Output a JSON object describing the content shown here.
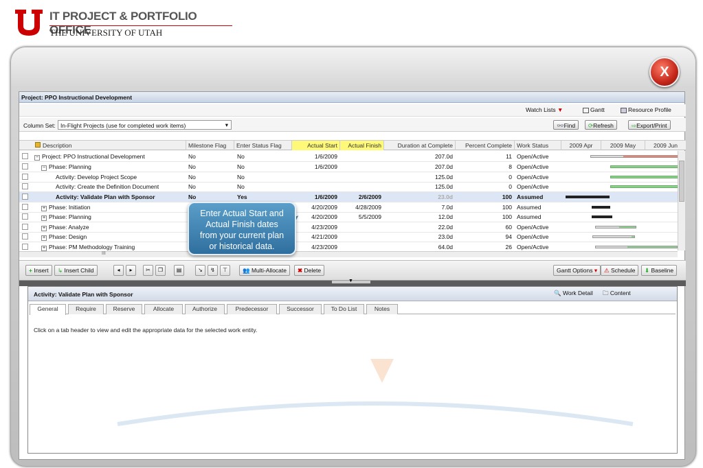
{
  "brand": {
    "title": "IT PROJECT & PORTFOLIO OFFICE",
    "subtitle": "THE UNIVERSITY OF UTAH",
    "logo_letter": "U"
  },
  "close_label": "X",
  "project_bar": "Project: PPO Instructional Development",
  "toolbar": {
    "watch_lists": "Watch Lists",
    "gantt": "Gantt",
    "resource_profile": "Resource Profile"
  },
  "column_set": {
    "label": "Column Set:",
    "value": "In-Flight Projects (use for completed work items)"
  },
  "buttons": {
    "find": "Find",
    "refresh": "Refresh",
    "export": "Export/Print"
  },
  "columns": [
    "Description",
    "Milestone Flag",
    "Enter Status Flag",
    "Actual Start",
    "Actual Finish",
    "Duration at Complete",
    "Percent Complete",
    "Work Status",
    "2009 Apr",
    "2009 May",
    "2009 Jun"
  ],
  "rows": [
    {
      "desc": "Project: PPO Instructional Development",
      "ms": "No",
      "esf": "No",
      "as": "1/6/2009",
      "af": "",
      "dur": "207.0d",
      "pct": "11",
      "ws": "Open/Active"
    },
    {
      "desc": "Phase: Planning",
      "ms": "No",
      "esf": "No",
      "as": "1/6/2009",
      "af": "",
      "dur": "207.0d",
      "pct": "8",
      "ws": "Open/Active"
    },
    {
      "desc": "Activity: Develop Project Scope",
      "ms": "No",
      "esf": "No",
      "as": "",
      "af": "",
      "dur": "125.0d",
      "pct": "0",
      "ws": "Open/Active"
    },
    {
      "desc": "Activity: Create the Definition Document",
      "ms": "No",
      "esf": "No",
      "as": "",
      "af": "",
      "dur": "125.0d",
      "pct": "0",
      "ws": "Open/Active"
    },
    {
      "desc": "Activity: Validate Plan with Sponsor",
      "ms": "No",
      "esf": "Yes",
      "as": "1/6/2009",
      "af": "2/6/2009",
      "dur": "23.0d",
      "pct": "100",
      "ws": "Assumed"
    },
    {
      "desc": "Phase: Initiation",
      "ms": "No",
      "esf": "",
      "as": "4/20/2009",
      "af": "4/28/2009",
      "dur": "7.0d",
      "pct": "100",
      "ws": "Assumed"
    },
    {
      "desc": "Phase: Planning",
      "ms": "",
      "esf": "",
      "as": "4/20/2009",
      "af": "5/5/2009",
      "dur": "12.0d",
      "pct": "100",
      "ws": "Assumed"
    },
    {
      "desc": "Phase: Analyze",
      "ms": "",
      "esf": "",
      "as": "4/23/2009",
      "af": "",
      "dur": "22.0d",
      "pct": "60",
      "ws": "Open/Active"
    },
    {
      "desc": "Phase: Design",
      "ms": "",
      "esf": "",
      "as": "4/21/2009",
      "af": "",
      "dur": "23.0d",
      "pct": "94",
      "ws": "Open/Active"
    },
    {
      "desc": "Phase: PM Methodology Training",
      "ms": "",
      "esf": "",
      "as": "4/23/2009",
      "af": "",
      "dur": "64.0d",
      "pct": "26",
      "ws": "Open/Active"
    }
  ],
  "scroll_mark": "III",
  "actions": {
    "insert": "Insert",
    "insert_child": "Insert Child",
    "multi_allocate": "Multi-Allocate",
    "delete": "Delete",
    "gantt_options": "Gantt Options",
    "schedule": "Schedule",
    "baseline": "Baseline"
  },
  "detail": {
    "title": "Activity: Validate Plan with Sponsor",
    "work_detail": "Work Detail",
    "content": "Content",
    "tabs": [
      "General",
      "Require",
      "Reserve",
      "Allocate",
      "Authorize",
      "Predecessor",
      "Successor",
      "To Do List",
      "Notes"
    ],
    "hint": "Click on a tab header to view and edit the appropriate data for the selected work entity."
  },
  "callout": [
    "Enter Actual Start and",
    "Actual Finish dates",
    "from your current plan",
    "or historical data."
  ],
  "colors": {
    "brand_red": "#cc0000",
    "highlight": "#fff97a",
    "callout": "#3f80ad",
    "gantt_green": "#8fd28f"
  }
}
